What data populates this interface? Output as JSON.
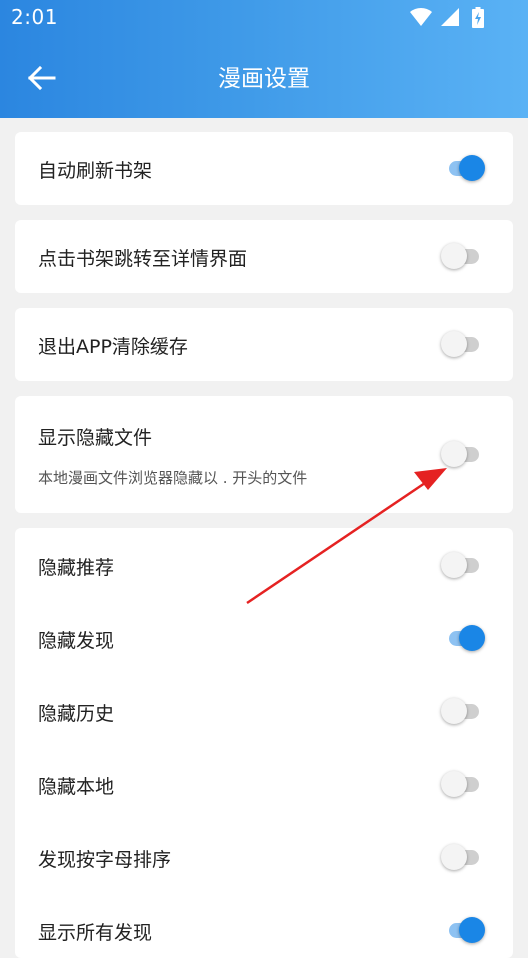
{
  "status_bar": {
    "time": "2:01",
    "icons": [
      "wifi-icon",
      "signal-icon",
      "battery-icon"
    ]
  },
  "app_bar": {
    "title": "漫画设置",
    "back_icon": "arrow-left-icon"
  },
  "colors": {
    "accent": "#1a86e6",
    "header_start": "#2b86e0",
    "header_end": "#5ab2f5",
    "annotation_arrow": "#e52222"
  },
  "settings": {
    "auto_refresh": {
      "label": "自动刷新书架",
      "on": true
    },
    "click_to_detail": {
      "label": "点击书架跳转至详情界面",
      "on": false
    },
    "clear_cache_on_exit": {
      "label": "退出APP清除缓存",
      "on": false
    },
    "show_hidden_files": {
      "label": "显示隐藏文件",
      "description": "本地漫画文件浏览器隐藏以 . 开头的文件",
      "on": false
    },
    "hide_recommend": {
      "label": "隐藏推荐",
      "on": false
    },
    "hide_discover": {
      "label": "隐藏发现",
      "on": true
    },
    "hide_history": {
      "label": "隐藏历史",
      "on": false
    },
    "hide_local": {
      "label": "隐藏本地",
      "on": false
    },
    "discover_alpha_sort": {
      "label": "发现按字母排序",
      "on": false
    },
    "show_all_discover": {
      "label": "显示所有发现",
      "on": true
    }
  }
}
